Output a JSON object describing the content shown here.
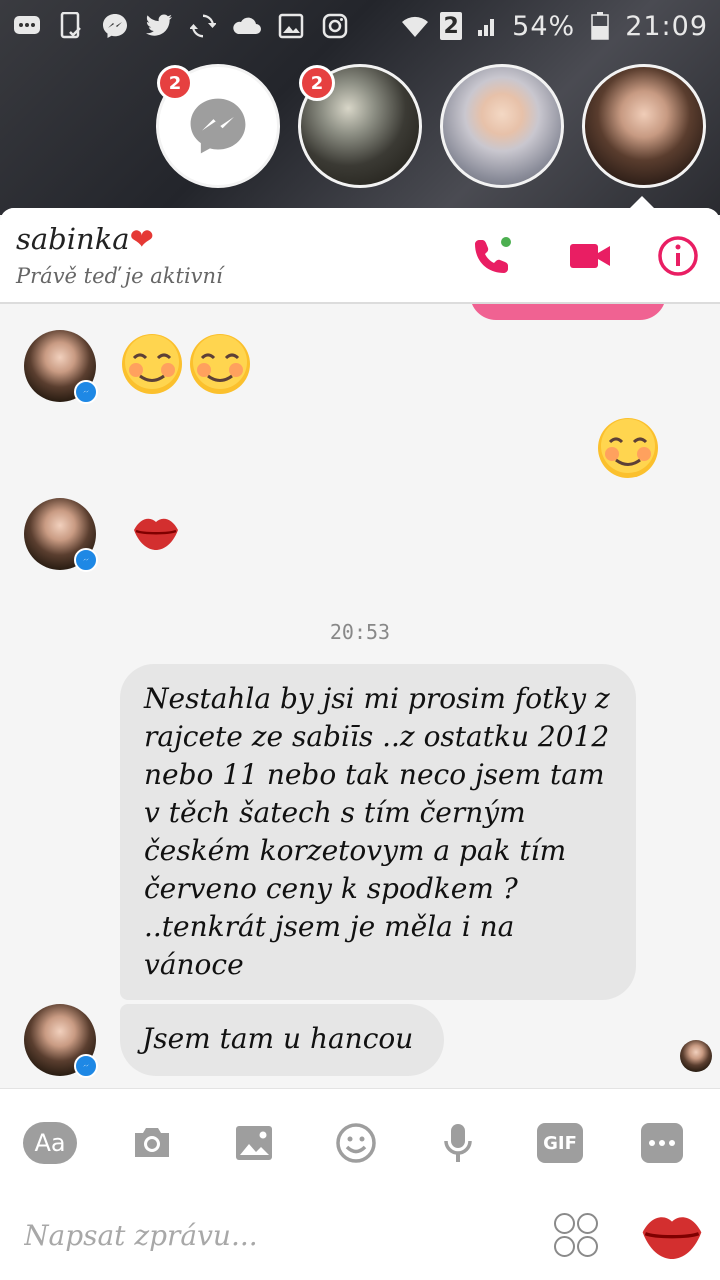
{
  "status_bar": {
    "battery": "54%",
    "time": "21:09",
    "sim_indicator": "2",
    "icons": [
      "chat-notification-icon",
      "phone-check-icon",
      "messenger-icon",
      "twitter-icon",
      "sync-icon",
      "cloud-icon",
      "image-icon",
      "instagram-icon",
      "wifi-icon",
      "signal-icon",
      "battery-icon"
    ]
  },
  "chat_heads": [
    {
      "name": "messenger-head",
      "badge": "2"
    },
    {
      "name": "contact-head-1",
      "badge": "2"
    },
    {
      "name": "contact-head-2",
      "badge": ""
    },
    {
      "name": "contact-head-active",
      "badge": ""
    }
  ],
  "header": {
    "contact_name": "sabinka",
    "heart": "❤",
    "status": "Právě teď je aktivní",
    "accent_color": "#e91e63"
  },
  "messages": {
    "timestamp": "20:53",
    "long_message": "Nestahla by jsi mi prosim fotky z rajcete ze sabiīs ..z ostatku 2012 nebo 11 nebo tak neco jsem tam v těch šatech s tím černým českém korzetovym a pak tím červeno ceny k spodkem ? ..tenkrát jsem je měla i na vánoce",
    "short_message": "Jsem tam u hancou"
  },
  "composer": {
    "aa_label": "Aa",
    "gif_label": "GIF",
    "placeholder": "Napsat zprávu..."
  }
}
